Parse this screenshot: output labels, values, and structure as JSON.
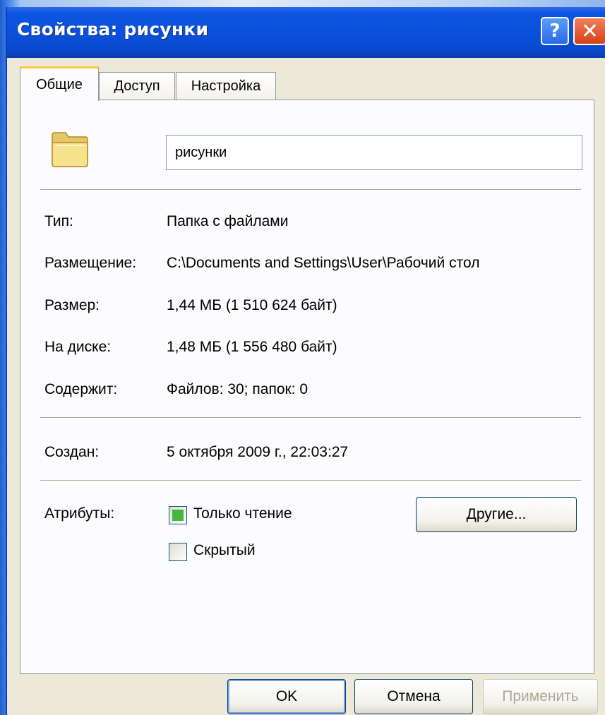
{
  "window": {
    "title": "Свойства: рисунки",
    "help_glyph": "?",
    "close_glyph": "✕"
  },
  "tabs": [
    {
      "label": "Общие",
      "active": true
    },
    {
      "label": "Доступ",
      "active": false
    },
    {
      "label": "Настройка",
      "active": false
    }
  ],
  "general": {
    "folder_icon": "folder-icon",
    "name_value": "рисунки",
    "type_label": "Тип:",
    "type_value": "Папка с файлами",
    "location_label": "Размещение:",
    "location_value": "C:\\Documents and Settings\\User\\Рабочий стол",
    "size_label": "Размер:",
    "size_value": "1,44 МБ (1 510 624 байт)",
    "disk_label": "На диске:",
    "disk_value": "1,48 МБ (1 556 480 байт)",
    "contains_label": "Содержит:",
    "contains_value": "Файлов: 30; папок: 0",
    "created_label": "Создан:",
    "created_value": "5 октября 2009 г., 22:03:27",
    "attributes_label": "Атрибуты:",
    "readonly_label": "Только чтение",
    "readonly_checked": true,
    "hidden_label": "Скрытый",
    "hidden_checked": false,
    "other_button": "Другие..."
  },
  "footer": {
    "ok": "OK",
    "cancel": "Отмена",
    "apply": "Применить"
  },
  "colors": {
    "titlebar": "#0a4fd8",
    "dialog_bg": "#ece9d8",
    "panel_bg": "#fcfcfe",
    "active_tab_accent": "#ffc83c",
    "checkbox_fill": "#41b83e",
    "close_button": "#d84018"
  }
}
